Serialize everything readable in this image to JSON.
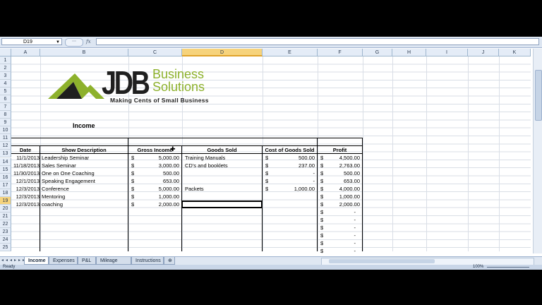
{
  "namebox": "D19",
  "formula_buttons": {
    "oval": "",
    "fx": "fx"
  },
  "columns": [
    "A",
    "B",
    "C",
    "D",
    "E",
    "F",
    "G",
    "H",
    "I",
    "J",
    "K"
  ],
  "rows": [
    "1",
    "2",
    "3",
    "4",
    "5",
    "6",
    "7",
    "8",
    "9",
    "10",
    "11",
    "12",
    "13",
    "14",
    "15",
    "16",
    "17",
    "18",
    "19",
    "20",
    "21",
    "22",
    "23",
    "24",
    "25"
  ],
  "logo": {
    "jdb": "JDB",
    "business": "Business",
    "solutions": "Solutions",
    "tagline": "Making Cents of Small Business"
  },
  "title": "Income",
  "headers": {
    "date": "Date",
    "show": "Show Description",
    "gross": "Gross Income",
    "goods": "Goods Sold",
    "cost": "Cost of Goods Sold",
    "profit": "Profit"
  },
  "table": [
    {
      "date": "11/1/2013",
      "desc": "Leadership Seminar",
      "gross": "5,000.00",
      "goods": "Training Manuals",
      "cost": "500.00",
      "profit": "4,500.00"
    },
    {
      "date": "11/18/2013",
      "desc": "Sales Seminar",
      "gross": "3,000.00",
      "goods": "CD's and booklets",
      "cost": "237.00",
      "profit": "2,763.00"
    },
    {
      "date": "11/30/2013",
      "desc": "One on One Coaching",
      "gross": "500.00",
      "goods": "",
      "cost": "-",
      "profit": "500.00"
    },
    {
      "date": "12/1/2013",
      "desc": "Speaking Engagement",
      "gross": "653.00",
      "goods": "",
      "cost": "-",
      "profit": "653.00"
    },
    {
      "date": "12/3/2013",
      "desc": "Conference",
      "gross": "5,000.00",
      "goods": "Packets",
      "cost": "1,000.00",
      "profit": "4,000.00"
    },
    {
      "date": "12/3/2013",
      "desc": "Mentoring",
      "gross": "1,000.00",
      "goods": "",
      "cost": "",
      "profit": "1,000.00"
    },
    {
      "date": "12/3/2013",
      "desc": "coaching",
      "gross": "2,000.00",
      "goods": "",
      "cost": "",
      "profit": "2,000.00"
    }
  ],
  "empty_profit": "-",
  "dollar": "$",
  "tabs": [
    "Income",
    "Expenses",
    "P&L",
    "Mileage Log",
    "Instructions"
  ],
  "status": {
    "ready": "Ready",
    "zoom": "100%"
  }
}
